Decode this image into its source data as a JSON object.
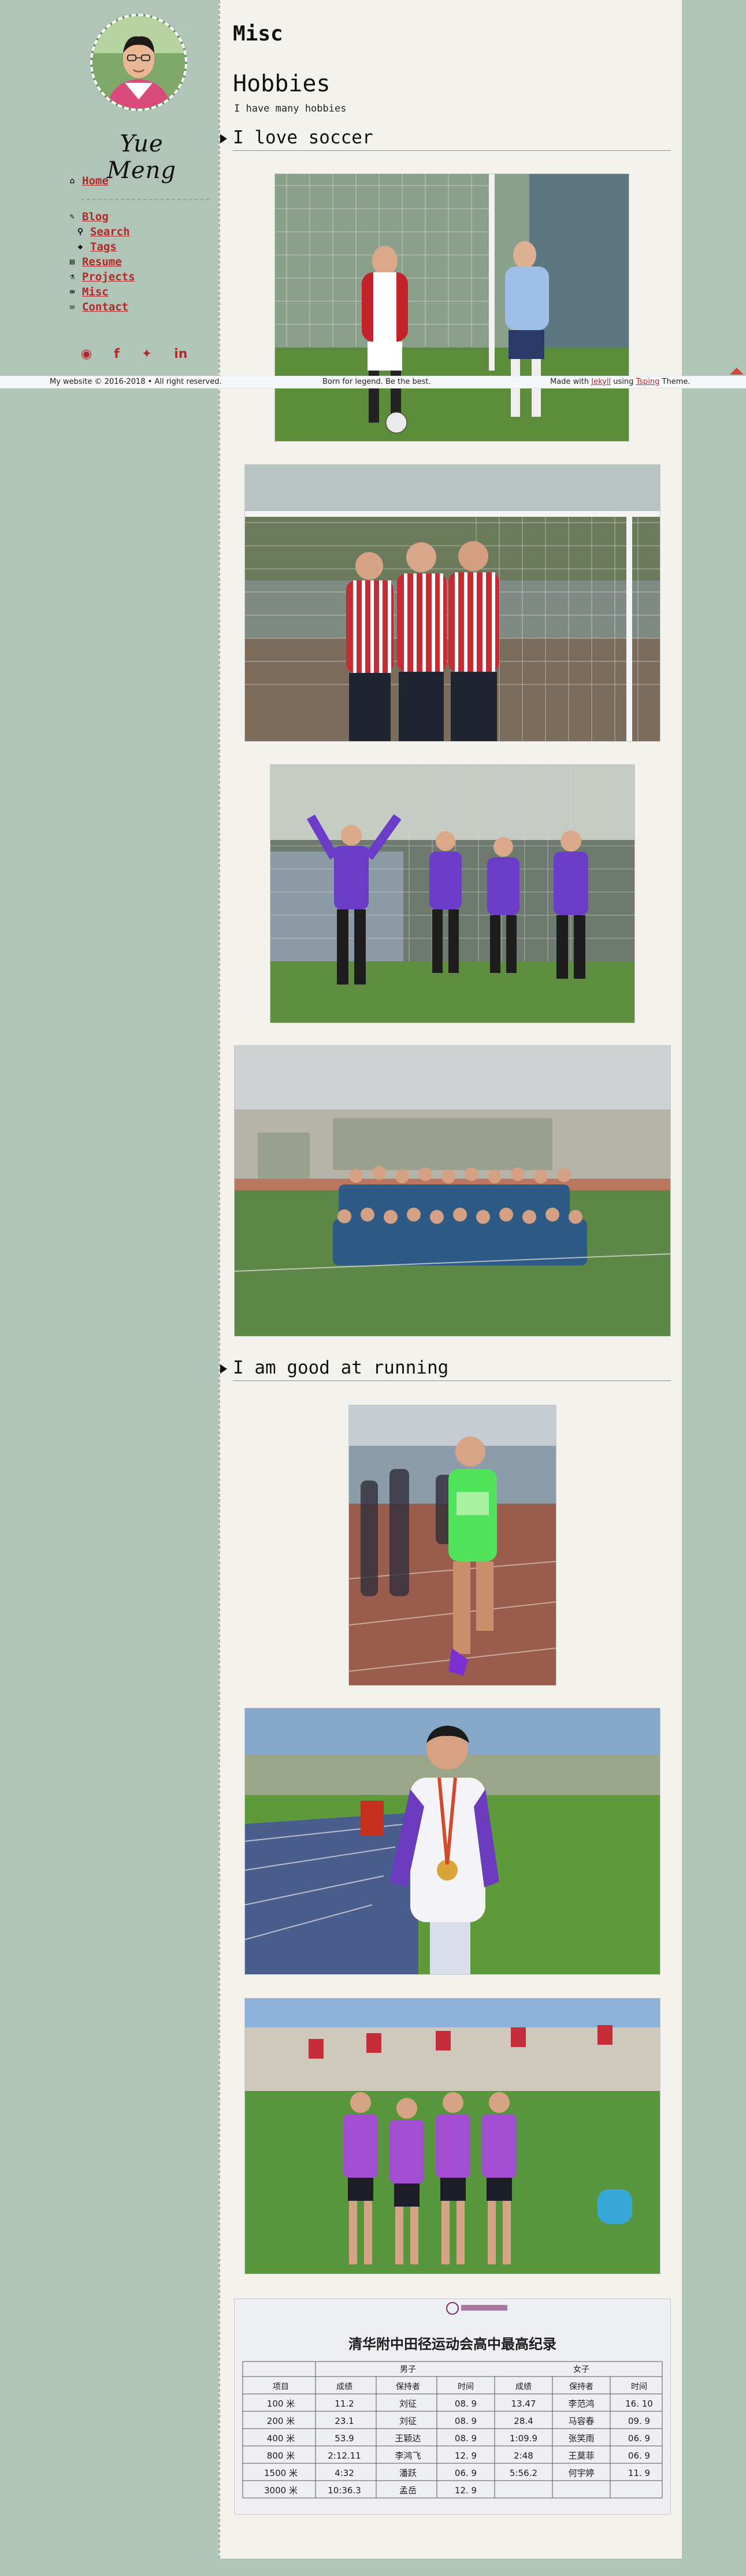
{
  "sidebar": {
    "site_title": "Yue Meng",
    "nav": [
      {
        "label": "Home",
        "icon": "home-icon"
      },
      {
        "label": "Blog",
        "icon": "pencil-icon"
      },
      {
        "label": "Search",
        "icon": "search-icon"
      },
      {
        "label": "Tags",
        "icon": "tags-icon"
      },
      {
        "label": "Resume",
        "icon": "document-icon"
      },
      {
        "label": "Projects",
        "icon": "flask-icon"
      },
      {
        "label": "Misc",
        "icon": "infinity-icon"
      },
      {
        "label": "Contact",
        "icon": "envelope-icon"
      }
    ],
    "social": [
      "github-icon",
      "facebook-icon",
      "twitter-icon",
      "linkedin-icon"
    ]
  },
  "main": {
    "page_title": "Misc",
    "section_title": "Hobbies",
    "section_desc": "I have many hobbies",
    "subsections": [
      {
        "title": "I love soccer"
      },
      {
        "title": "I am good at running"
      }
    ],
    "record_sheet": {
      "caption": "清华附中田径运动会高中最高纪录",
      "col_groups": [
        "男子",
        "女子"
      ],
      "headers": [
        "项目",
        "成绩",
        "保持者",
        "时间",
        "成绩",
        "保持者",
        "时间"
      ],
      "rows": [
        [
          "100 米",
          "11.2",
          "刘征",
          "08. 9",
          "13.47",
          "李范鸿",
          "16. 10"
        ],
        [
          "200 米",
          "23.1",
          "刘征",
          "08. 9",
          "28.4",
          "马容春",
          "09. 9"
        ],
        [
          "400 米",
          "53.9",
          "王颖达",
          "08. 9",
          "1:09.9",
          "张笑雨",
          "06. 9"
        ],
        [
          "800 米",
          "2:12.11",
          "李鸿飞",
          "12. 9",
          "2:48",
          "王莫菲",
          "06. 9"
        ],
        [
          "1500 米",
          "4:32",
          "潘跃",
          "06. 9",
          "5:56.2",
          "何宇婷",
          "11. 9"
        ],
        [
          "3000 米",
          "10:36.3",
          "孟岳",
          "12. 9",
          "",
          "",
          ""
        ]
      ]
    }
  },
  "footer": {
    "left": "My website © 2016-2018 • All right reserved.",
    "middle": "Born for legend. Be the best.",
    "right_prefix": "Made with ",
    "right_link1": "Jekyll",
    "right_mid": " using ",
    "right_link2": "Tsping",
    "right_suffix": " Theme."
  },
  "colors": {
    "sidebar_bg": "#b0c5b8",
    "content_bg": "#f4f2ec",
    "link": "#b02a2a",
    "scroll_top": "#d0473d"
  }
}
